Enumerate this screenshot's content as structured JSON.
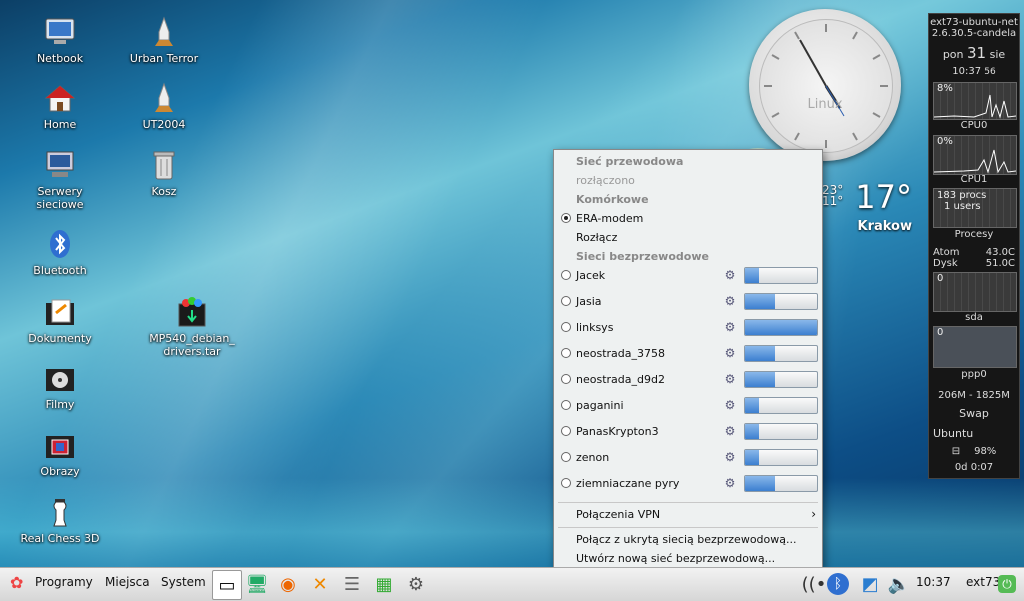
{
  "desktop_icons": [
    {
      "label": "Netbook",
      "icon": "computer-icon"
    },
    {
      "label": "Urban Terror",
      "icon": "rocket-icon"
    },
    {
      "label": "Home",
      "icon": "home-icon"
    },
    {
      "label": "UT2004",
      "icon": "rocket-icon"
    },
    {
      "label": "Serwery sieciowe",
      "icon": "network-icon"
    },
    {
      "label": "Kosz",
      "icon": "trash-icon"
    },
    {
      "label": "Bluetooth",
      "icon": "bluetooth-icon"
    },
    {
      "label": "Dokumenty",
      "icon": "folder-documents-icon"
    },
    {
      "label": "MP540_debian_ drivers.tar",
      "icon": "archive-icon"
    },
    {
      "label": "Filmy",
      "icon": "folder-video-icon"
    },
    {
      "label": "Obrazy",
      "icon": "folder-pictures-icon"
    },
    {
      "label": "Real Chess 3D",
      "icon": "chess-icon"
    }
  ],
  "clock": {
    "brand": "Linux"
  },
  "weather": {
    "temperature": "17°",
    "small_line1": "23°",
    "small_line2": "11°",
    "city": "Krakow"
  },
  "conky": {
    "host": "ext73-ubuntu-net",
    "kernel": "2.6.30.5-candela",
    "day": "pon",
    "date": "31",
    "month": "sie",
    "time": "10:37",
    "seconds": "56",
    "cpu0_pct": "8%",
    "cpu0_label": "CPU0",
    "cpu1_pct": "0%",
    "cpu1_label": "CPU1",
    "procs": "183 procs",
    "users": "1 users",
    "procs_label": "Procesy",
    "atom_label": "Atom",
    "atom_temp": "43.0C",
    "disk_label": "Dysk",
    "disk_temp": "51.0C",
    "sda_value": "0",
    "sda_label": "sda",
    "ppp_value": "0",
    "ppp_label": "ppp0",
    "mem": "206M - 1825M",
    "swap_label": "Swap",
    "distro": "Ubuntu",
    "battery": "98%",
    "uptime": "0d 0:07"
  },
  "network_menu": {
    "wired_header": "Sieć przewodowa",
    "wired_status": "rozłączono",
    "mobile_header": "Komórkowe",
    "mobile_conn": "ERA-modem",
    "disconnect": "Rozłącz",
    "wireless_header": "Sieci bezprzewodowe",
    "networks": [
      {
        "name": "Jacek",
        "signal": 0.2
      },
      {
        "name": "Jasia",
        "signal": 0.42
      },
      {
        "name": "linksys",
        "signal": 1.0
      },
      {
        "name": "neostrada_3758",
        "signal": 0.42
      },
      {
        "name": "neostrada_d9d2",
        "signal": 0.42
      },
      {
        "name": "paganini",
        "signal": 0.2
      },
      {
        "name": "PanasKrypton3",
        "signal": 0.2
      },
      {
        "name": "zenon",
        "signal": 0.2
      },
      {
        "name": "ziemniaczane pyry",
        "signal": 0.42
      }
    ],
    "vpn": "Połączenia VPN",
    "hidden": "Połącz z ukrytą siecią bezprzewodową...",
    "new_net": "Utwórz nową sieć bezprzewodową..."
  },
  "taskbar": {
    "programs": "Programy",
    "places": "Miejsca",
    "system": "System",
    "time": "10:37",
    "user": "ext73"
  }
}
